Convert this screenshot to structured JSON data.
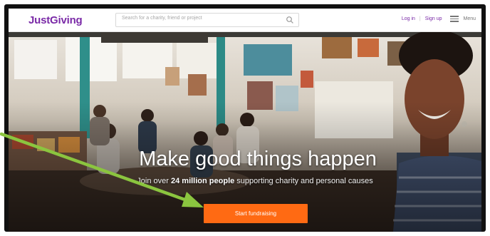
{
  "header": {
    "logo": "JustGiving",
    "search_placeholder": "Search for a charity, friend or project",
    "login": "Log in",
    "separator": "|",
    "signup": "Sign up",
    "menu": "Menu"
  },
  "hero": {
    "headline": "Make good things happen",
    "sub_prefix": "Join over ",
    "sub_bold": "24 million people",
    "sub_suffix": " supporting charity and personal causes",
    "cta": "Start fundraising"
  },
  "colors": {
    "brand_purple": "#7a2aa7",
    "cta_orange": "#ff6a13",
    "annotation_arrow": "#8bc53f"
  }
}
